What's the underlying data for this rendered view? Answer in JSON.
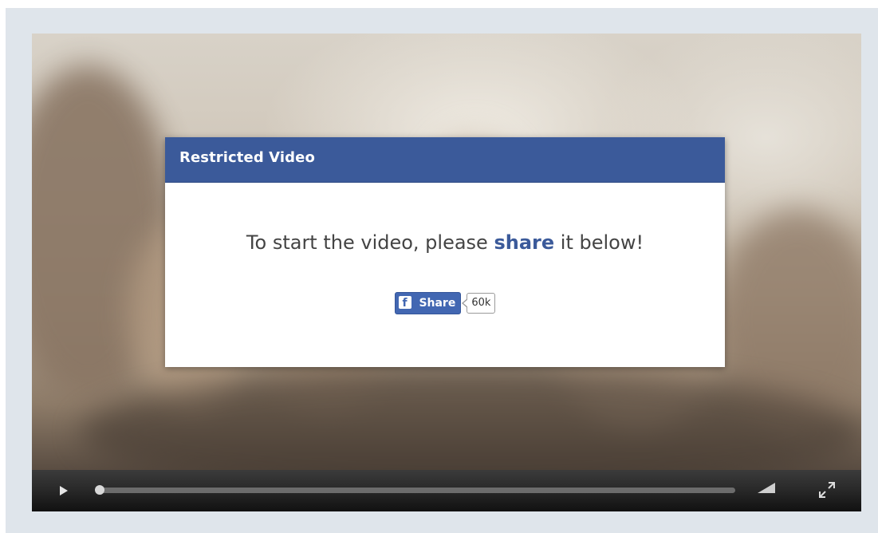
{
  "modal": {
    "title": "Restricted Video",
    "message_prefix": "To start the video, please ",
    "message_highlight": "share",
    "message_suffix": " it below!",
    "share_button_label": "Share",
    "share_count": "60k"
  },
  "player": {
    "progress": 0.0
  },
  "icons": {
    "play": "play-icon",
    "facebook": "facebook-icon",
    "volume": "volume-icon",
    "fullscreen": "fullscreen-icon"
  },
  "colors": {
    "modal_header": "#3b5a9a",
    "share_button": "#4267b2",
    "player_controls": "#2a2a2a",
    "page_background": "#dfe5eb"
  }
}
